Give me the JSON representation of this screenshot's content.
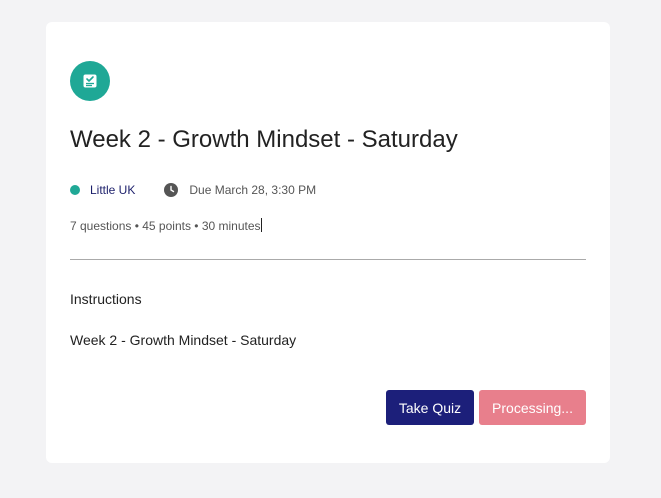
{
  "quiz": {
    "icon": "quiz-checklist-icon",
    "title": "Week 2 - Growth Mindset - Saturday",
    "class_name": "Little UK",
    "due": "Due March 28, 3:30 PM",
    "stats": "7 questions • 45 points • 30 minutes",
    "instructions_heading": "Instructions",
    "instructions_body": "Week 2 - Growth Mindset - Saturday"
  },
  "actions": {
    "take_quiz_label": "Take Quiz",
    "processing_label": "Processing..."
  },
  "colors": {
    "accent_teal": "#1fa896",
    "primary_navy": "#1c1f7a",
    "processing_pink": "#e87f8c",
    "background": "#f3f3f5"
  }
}
